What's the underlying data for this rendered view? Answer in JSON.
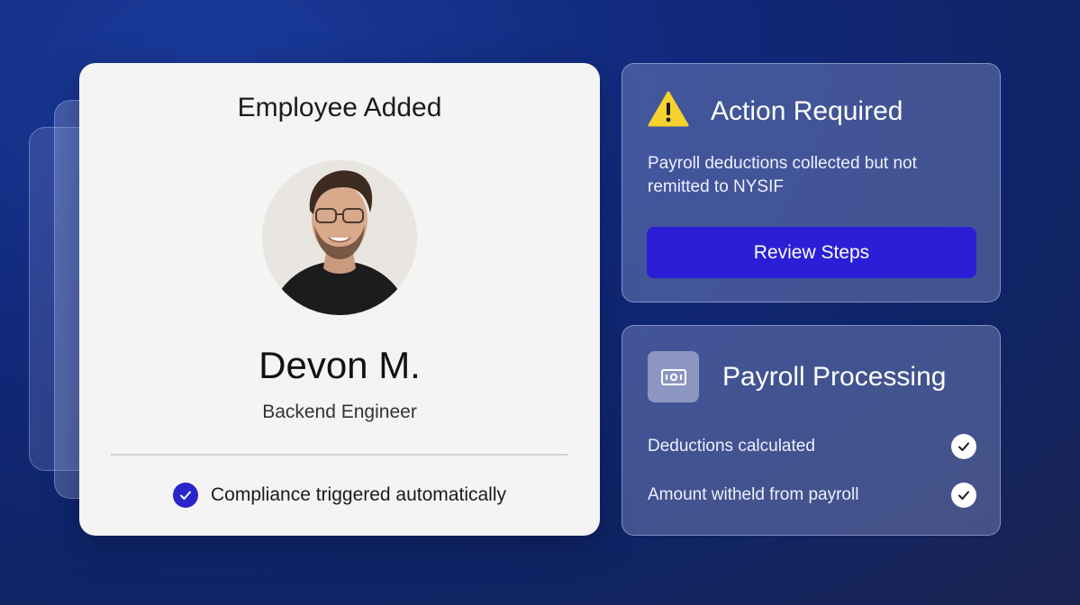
{
  "employee_card": {
    "title": "Employee Added",
    "name": "Devon M.",
    "role": "Backend Engineer",
    "compliance_text": "Compliance triggered automatically",
    "check_color": "#2a25c8"
  },
  "action_card": {
    "icon": "warning-icon",
    "title": "Action Required",
    "description": "Payroll deductions collected but not remitted to NYSIF",
    "button_label": "Review Steps",
    "button_color": "#2a1fd6"
  },
  "payroll_card": {
    "icon": "money-icon",
    "title": "Payroll Processing",
    "items": [
      {
        "label": "Deductions calculated",
        "status": "checked"
      },
      {
        "label": "Amount witheld from payroll",
        "status": "checked"
      }
    ]
  }
}
